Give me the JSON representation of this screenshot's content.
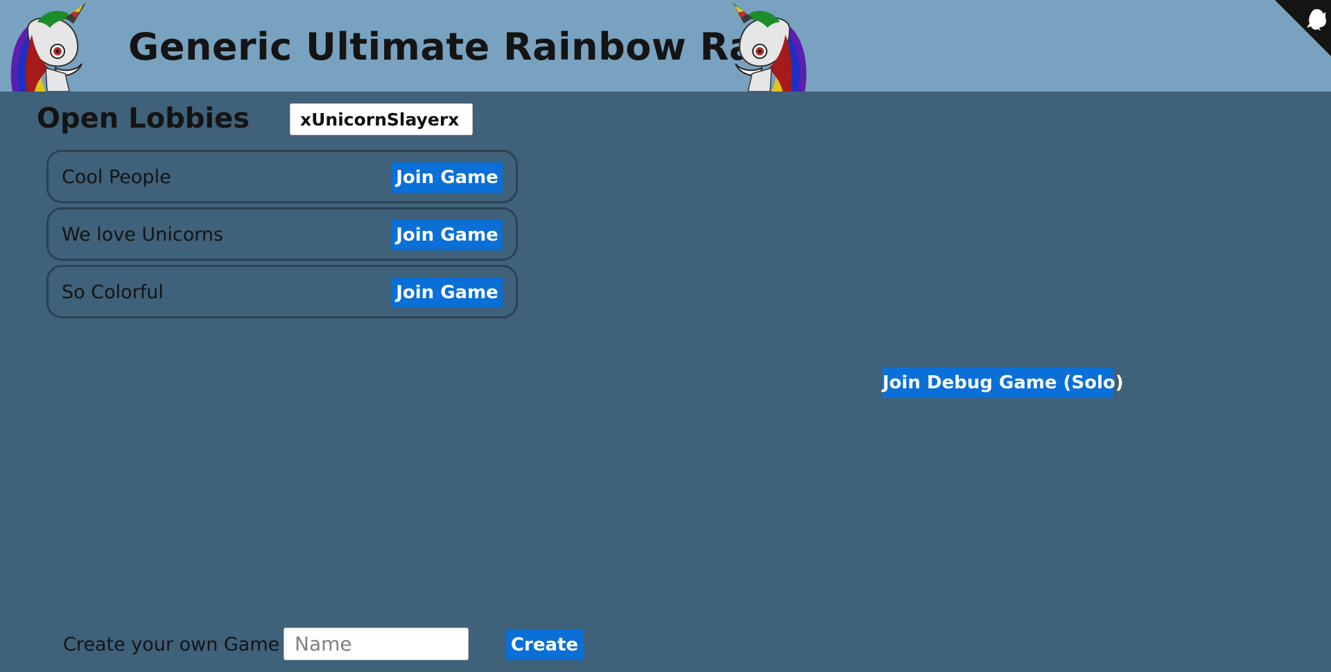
{
  "header": {
    "title": "Generic Ultimate Rainbow Race",
    "logo_icon": "unicorn-icon",
    "corner_icon": "github-cat-icon"
  },
  "lobbies": {
    "heading": "Open Lobbies",
    "player_name_value": "xUnicornSlayerx",
    "items": [
      {
        "name": "Cool People",
        "button_label": "Join Game"
      },
      {
        "name": "We love Unicorns",
        "button_label": "Join Game"
      },
      {
        "name": "So Colorful",
        "button_label": "Join Game"
      }
    ]
  },
  "debug": {
    "button_label": "Join Debug Game (Solo)"
  },
  "create": {
    "label": "Create your own Game",
    "placeholder": "Name",
    "button_label": "Create"
  },
  "colors": {
    "header_bg": "#78a2bf",
    "page_bg": "#3f6179",
    "button_bg": "#0a6fd6"
  }
}
